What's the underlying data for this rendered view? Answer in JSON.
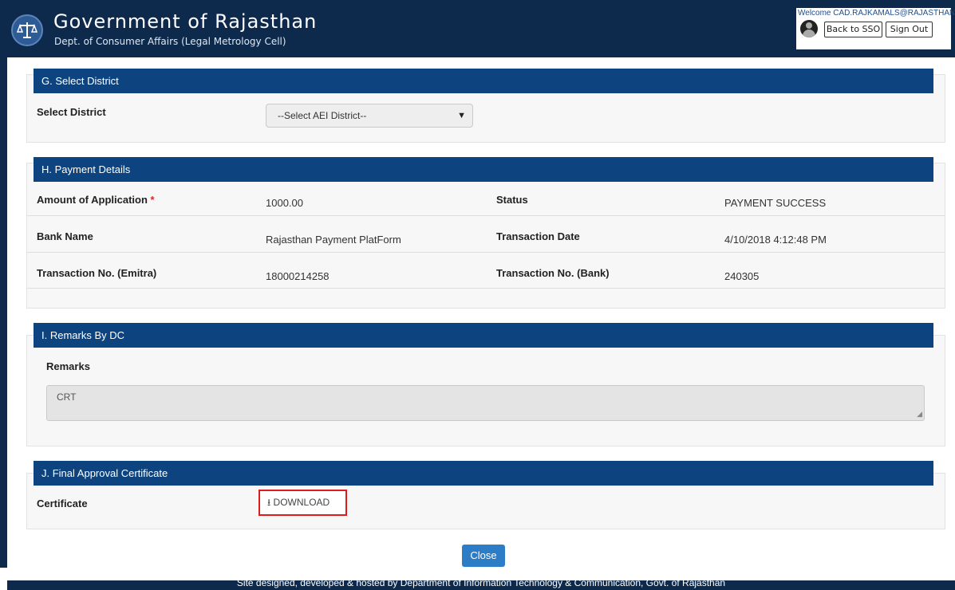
{
  "header": {
    "title": "Government of Rajasthan",
    "subtitle": "Dept. of Consumer Affairs (Legal Metrology Cell)",
    "welcome": "Welcome CAD.RAJKAMALS@RAJASTHAN...",
    "back_to_sso": "Back to SSO",
    "sign_out": "Sign Out"
  },
  "section_g": {
    "heading": "G. Select District",
    "label": "Select District",
    "select_value": "--Select AEI District--"
  },
  "section_h": {
    "heading": "H. Payment Details",
    "amount_label": "Amount of Application",
    "required_mark": "*",
    "amount_value": "1000.00",
    "status_label": "Status",
    "status_value": "PAYMENT SUCCESS",
    "bank_label": "Bank Name",
    "bank_value": "Rajasthan Payment PlatForm",
    "txn_date_label": "Transaction Date",
    "txn_date_value": "4/10/2018 4:12:48 PM",
    "txn_emitra_label": "Transaction No. (Emitra)",
    "txn_emitra_value": "18000214258",
    "txn_bank_label": "Transaction No. (Bank)",
    "txn_bank_value": "240305"
  },
  "section_i": {
    "heading": "I. Remarks By DC",
    "label": "Remarks",
    "value": "CRT"
  },
  "section_j": {
    "heading": "J. Final Approval Certificate",
    "label": "Certificate",
    "download_label": "DOWNLOAD"
  },
  "close_label": "Close",
  "footer_text": "Site designed, developed & hosted by Department of Information Technology & Communication, Govt. of Rajasthan",
  "icons": [
    "scales-emblem-icon",
    "user-avatar-icon",
    "chevron-down-icon",
    "download-icon",
    "resize-handle-icon"
  ]
}
